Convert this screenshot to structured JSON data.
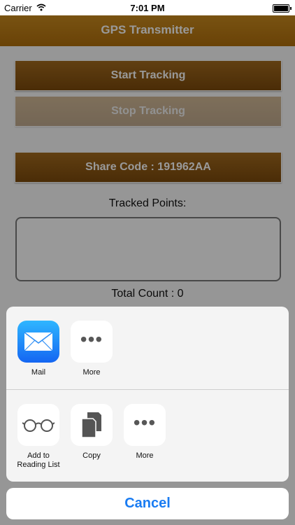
{
  "status_bar": {
    "carrier": "Carrier",
    "time": "7:01 PM",
    "wifi_icon": "wifi-icon",
    "battery_icon": "battery-icon"
  },
  "nav": {
    "title": "GPS Transmitter"
  },
  "buttons": {
    "start": "Start Tracking",
    "stop": "Stop Tracking",
    "share": "Share Code : 191962AA"
  },
  "tracked": {
    "label": "Tracked Points:",
    "points": ""
  },
  "total": {
    "label": "Total Count : 0"
  },
  "share_sheet": {
    "apps": [
      {
        "label": "Mail",
        "icon": "mail-icon"
      },
      {
        "label": "More",
        "icon": "more-icon"
      }
    ],
    "actions": [
      {
        "label": "Add to\nReading List",
        "icon": "glasses-icon"
      },
      {
        "label": "Copy",
        "icon": "copy-icon"
      },
      {
        "label": "More",
        "icon": "more-icon"
      }
    ],
    "cancel": "Cancel"
  }
}
